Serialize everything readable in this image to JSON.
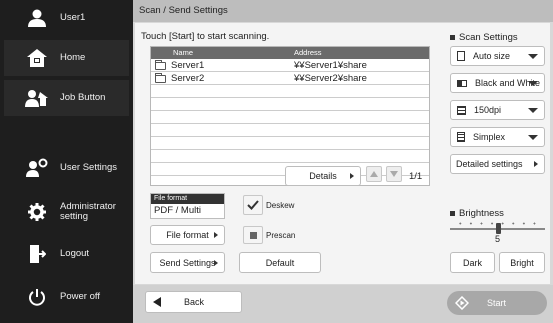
{
  "sidebar": {
    "user": "User1",
    "home": "Home",
    "job_button": "Job Button",
    "user_settings": "User Settings",
    "admin_line1": "Administrator",
    "admin_line2": "setting",
    "logout": "Logout",
    "power_off": "Power off"
  },
  "main": {
    "title": "Scan / Send Settings",
    "instruction": "Touch [Start] to start scanning.",
    "table": {
      "columns": [
        "Name",
        "Address"
      ],
      "rows": [
        {
          "name": "Server1",
          "address": "¥¥Server1¥share"
        },
        {
          "name": "Server2",
          "address": "¥¥Server2¥share"
        }
      ]
    },
    "details_label": "Details",
    "page_indicator": "1/1",
    "file_format_label": "File format",
    "file_format_value": "PDF / Multi",
    "deskew_label": "Deskew",
    "file_format_button": "File format",
    "prescan_label": "Prescan",
    "send_settings_button": "Send Settings",
    "default_button": "Default",
    "back_button": "Back",
    "start_button": "Start"
  },
  "scan_settings": {
    "title": "Scan Settings",
    "size": "Auto size",
    "color": "Black and White",
    "resolution": "150dpi",
    "sides": "Simplex",
    "detailed_button": "Detailed settings"
  },
  "brightness": {
    "title": "Brightness",
    "value": "5",
    "level_fraction": 0.5,
    "dark_label": "Dark",
    "bright_label": "Bright"
  }
}
